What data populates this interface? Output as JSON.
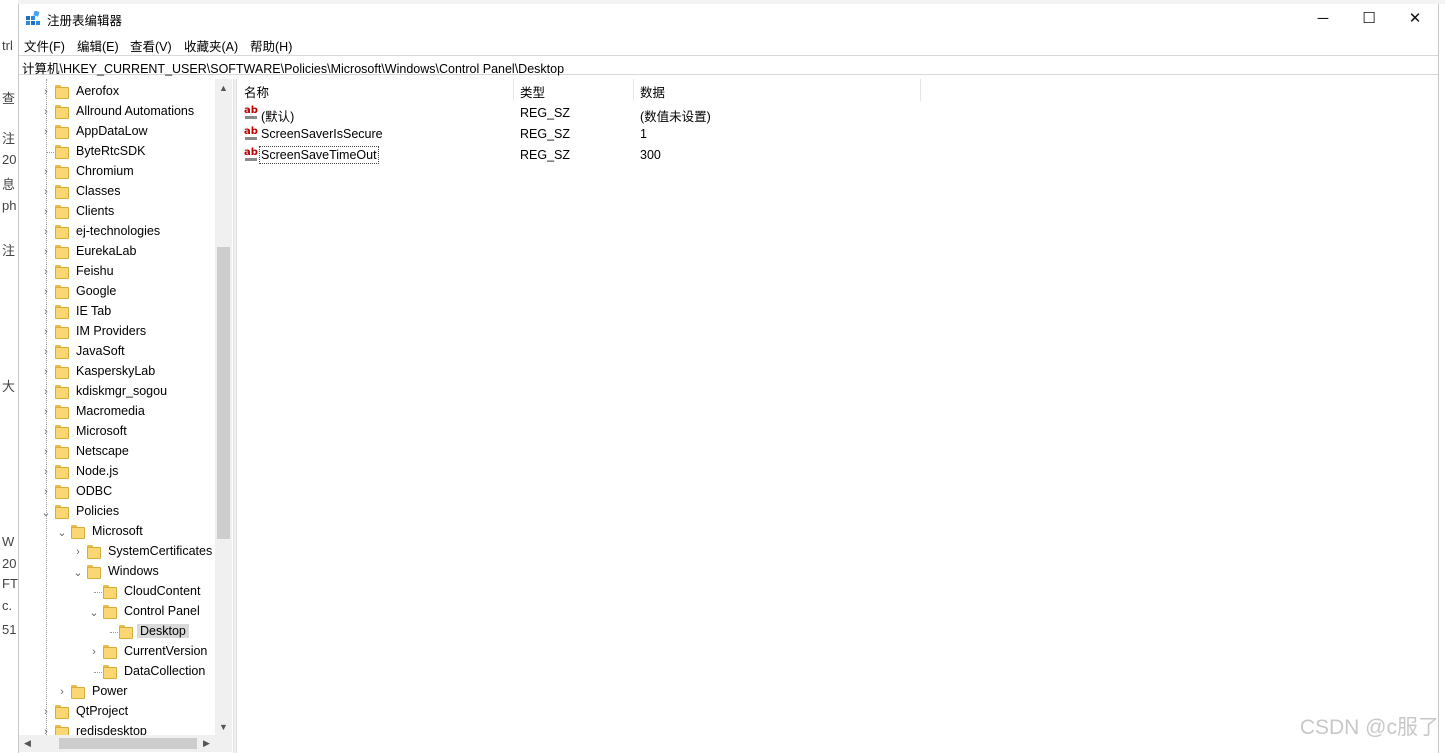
{
  "window": {
    "title": "注册表编辑器",
    "minimize_glyph": "─",
    "maximize_glyph": "☐",
    "close_glyph": "✕"
  },
  "menu": [
    "文件(F)",
    "编辑(E)",
    "查看(V)",
    "收藏夹(A)",
    "帮助(H)"
  ],
  "address": "计算机\\HKEY_CURRENT_USER\\SOFTWARE\\Policies\\Microsoft\\Windows\\Control Panel\\Desktop",
  "tree": [
    {
      "label": "Aerofox",
      "depth": 0,
      "expander": ">"
    },
    {
      "label": "Allround Automations",
      "depth": 0,
      "expander": ">"
    },
    {
      "label": "AppDataLow",
      "depth": 0,
      "expander": ">"
    },
    {
      "label": "ByteRtcSDK",
      "depth": 0,
      "expander": ""
    },
    {
      "label": "Chromium",
      "depth": 0,
      "expander": ">"
    },
    {
      "label": "Classes",
      "depth": 0,
      "expander": ">"
    },
    {
      "label": "Clients",
      "depth": 0,
      "expander": ">"
    },
    {
      "label": "ej-technologies",
      "depth": 0,
      "expander": ">"
    },
    {
      "label": "EurekaLab",
      "depth": 0,
      "expander": ">"
    },
    {
      "label": "Feishu",
      "depth": 0,
      "expander": ">"
    },
    {
      "label": "Google",
      "depth": 0,
      "expander": ">"
    },
    {
      "label": "IE Tab",
      "depth": 0,
      "expander": ">"
    },
    {
      "label": "IM Providers",
      "depth": 0,
      "expander": ">"
    },
    {
      "label": "JavaSoft",
      "depth": 0,
      "expander": ">"
    },
    {
      "label": "KasperskyLab",
      "depth": 0,
      "expander": ">"
    },
    {
      "label": "kdiskmgr_sogou",
      "depth": 0,
      "expander": ">"
    },
    {
      "label": "Macromedia",
      "depth": 0,
      "expander": ">"
    },
    {
      "label": "Microsoft",
      "depth": 0,
      "expander": ">"
    },
    {
      "label": "Netscape",
      "depth": 0,
      "expander": ">"
    },
    {
      "label": "Node.js",
      "depth": 0,
      "expander": ">"
    },
    {
      "label": "ODBC",
      "depth": 0,
      "expander": ">"
    },
    {
      "label": "Policies",
      "depth": 0,
      "expander": "v"
    },
    {
      "label": "Microsoft",
      "depth": 1,
      "expander": "v"
    },
    {
      "label": "SystemCertificates",
      "depth": 2,
      "expander": ">"
    },
    {
      "label": "Windows",
      "depth": 2,
      "expander": "v"
    },
    {
      "label": "CloudContent",
      "depth": 3,
      "expander": ""
    },
    {
      "label": "Control Panel",
      "depth": 3,
      "expander": "v"
    },
    {
      "label": "Desktop",
      "depth": 4,
      "expander": "",
      "selected": true
    },
    {
      "label": "CurrentVersion",
      "depth": 3,
      "expander": ">"
    },
    {
      "label": "DataCollection",
      "depth": 3,
      "expander": ""
    },
    {
      "label": "Power",
      "depth": 1,
      "expander": ">"
    },
    {
      "label": "QtProject",
      "depth": 0,
      "expander": ">"
    },
    {
      "label": "redisdesktop",
      "depth": 0,
      "expander": ">"
    }
  ],
  "list": {
    "columns": [
      "名称",
      "类型",
      "数据"
    ],
    "rows": [
      {
        "name": "(默认)",
        "type": "REG_SZ",
        "data": "(数值未设置)"
      },
      {
        "name": "ScreenSaverIsSecure",
        "type": "REG_SZ",
        "data": "1"
      },
      {
        "name": "ScreenSaveTimeOut",
        "type": "REG_SZ",
        "data": "300",
        "focused": true
      }
    ],
    "value_icon_text": "ab"
  },
  "background_fragments": [
    "trl",
    "查",
    "注",
    "20",
    "息",
    "ph",
    "注",
    "大",
    "W",
    "20",
    "FT",
    "c.",
    "51"
  ],
  "watermark": "CSDN @c服了"
}
